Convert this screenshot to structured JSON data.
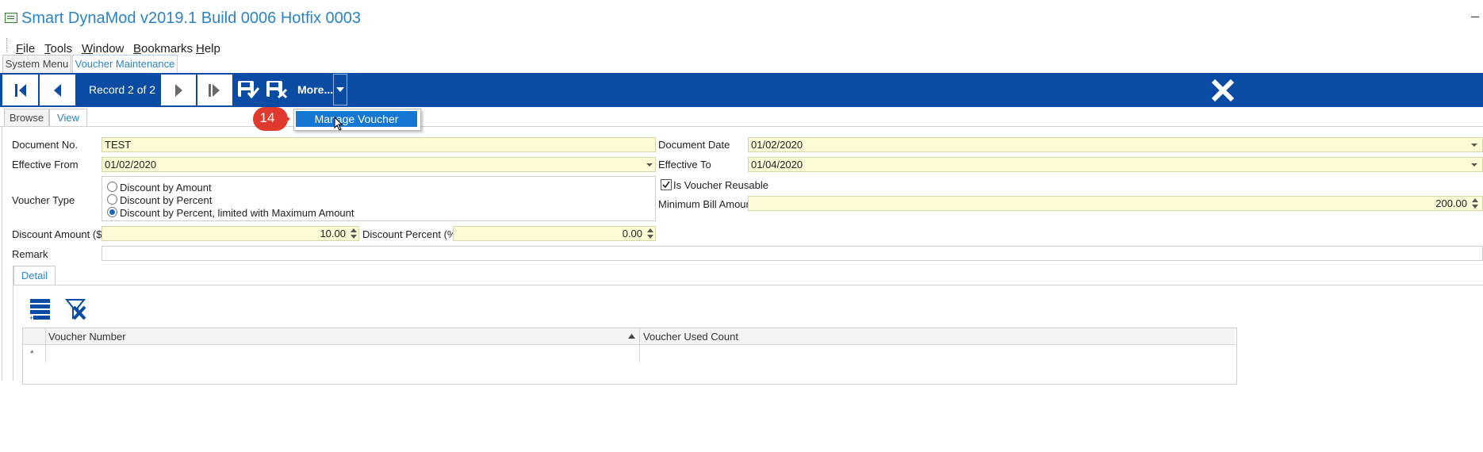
{
  "window": {
    "title": "Smart DynaMod v2019.1 Build 0006 Hotfix 0003",
    "minimize_glyph": "–"
  },
  "menu": [
    "File",
    "Tools",
    "Window",
    "Bookmarks",
    "Help"
  ],
  "main_tabs": [
    "System Menu",
    "Voucher Maintenance"
  ],
  "toolbar": {
    "record_label": "Record 2 of 2",
    "more_label": "More...",
    "accent_color": "#0a4ca3"
  },
  "popup": {
    "item_label": "Manage Voucher",
    "step_badge": "14",
    "badge_color": "#e03a2f"
  },
  "view_tabs": [
    "Browse",
    "View"
  ],
  "form": {
    "document_no": {
      "label": "Document No.",
      "value": "TEST"
    },
    "document_date": {
      "label": "Document Date",
      "value": "01/02/2020"
    },
    "effective_from": {
      "label": "Effective From",
      "value": "01/02/2020"
    },
    "effective_to": {
      "label": "Effective To",
      "value": "01/04/2020"
    },
    "voucher_type": {
      "label": "Voucher Type",
      "options": [
        "Discount by Amount",
        "Discount by Percent",
        "Discount by Percent, limited with Maximum Amount"
      ],
      "selected_index": 2
    },
    "is_reusable": {
      "label": "Is Voucher Reusable",
      "checked": true
    },
    "minimum_bill": {
      "label": "Minimum Bill Amount",
      "value": "200.00"
    },
    "discount_amount": {
      "label": "Discount Amount ($)",
      "value": "10.00"
    },
    "discount_percent": {
      "label": "Discount Percent (%)",
      "value": "0.00"
    },
    "remark": {
      "label": "Remark",
      "value": ""
    }
  },
  "detail": {
    "tab_label": "Detail",
    "columns": [
      "Voucher Number",
      "Voucher Used Count"
    ],
    "new_row_glyph": "*"
  }
}
